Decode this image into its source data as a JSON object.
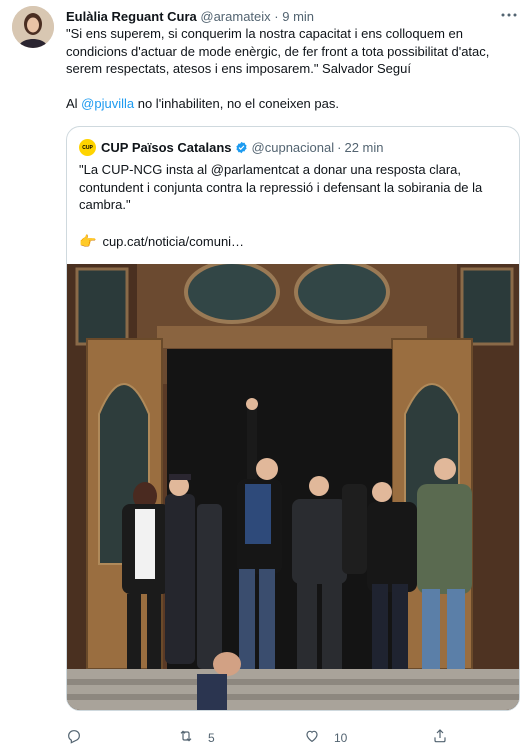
{
  "tweet": {
    "display_name": "Eulàlia Reguant Cura",
    "handle": "@aramateix",
    "dot": "·",
    "time": "9 min",
    "paragraph1": "\"Si ens superem, si conquerim la nostra capacitat i ens colloquem en condicions d'actuar de mode enèrgic, de fer front a tota possibilitat d'atac, serem respectats, atesos i ens imposarem.\" Salvador Seguí",
    "p2_prefix": "Al ",
    "p2_mention": "@pjuvilla",
    "p2_suffix": " no l'inhabiliten, no el coneixen pas."
  },
  "quote": {
    "avatar_text": "CUP",
    "display_name": "CUP Països Catalans",
    "handle": "@cupnacional",
    "dot": "·",
    "time": "22 min",
    "text": "\"La CUP-NCG insta al @parlamentcat a donar una resposta clara, contundent i conjunta contra la repressió i defensant la sobirania de la cambra.\"",
    "link_emoji": "👉",
    "link": "cup.cat/noticia/comuni…"
  },
  "actions": {
    "retweets": "5",
    "likes": "10"
  },
  "colors": {
    "accent": "#1d9bf0",
    "secondary_text": "#536471",
    "border": "#cfd9de"
  },
  "icons": [
    "more-icon",
    "verified-icon",
    "reply-icon",
    "retweet-icon",
    "like-icon",
    "share-icon"
  ]
}
